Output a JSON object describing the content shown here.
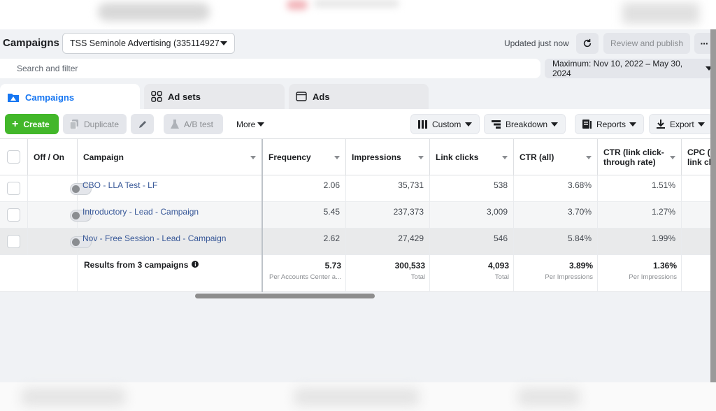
{
  "header": {
    "title": "Campaigns",
    "account": "TSS Seminole Advertising (335114927...",
    "updated": "Updated just now",
    "review_publish": "Review and publish"
  },
  "search": {
    "placeholder": "Search and filter"
  },
  "date_range": "Maximum: Nov 10, 2022 – May 30, 2024",
  "tabs": [
    {
      "label": "Campaigns",
      "icon": "folder-icon",
      "active": true
    },
    {
      "label": "Ad sets",
      "icon": "grid-icon",
      "active": false
    },
    {
      "label": "Ads",
      "icon": "ad-window-icon",
      "active": false
    }
  ],
  "toolbar": {
    "create": "Create",
    "duplicate": "Duplicate",
    "ab_test": "A/B test",
    "more": "More",
    "custom": "Custom",
    "breakdown": "Breakdown",
    "reports": "Reports",
    "export": "Export"
  },
  "columns": {
    "off_on": "Off / On",
    "campaign": "Campaign",
    "frequency": "Frequency",
    "impressions": "Impressions",
    "link_clicks": "Link clicks",
    "ctr_all": "CTR (all)",
    "ctr_link_1": "CTR (link click-",
    "ctr_link_2": "through rate)",
    "cpc_1": "CPC (c",
    "cpc_2": "link clic"
  },
  "rows": [
    {
      "campaign": "CBO - LLA Test - LF",
      "frequency": "2.06",
      "impressions": "35,731",
      "link_clicks": "538",
      "ctr_all": "3.68%",
      "ctr_link": "1.51%"
    },
    {
      "campaign": "Introductory - Lead - Campaign",
      "frequency": "5.45",
      "impressions": "237,373",
      "link_clicks": "3,009",
      "ctr_all": "3.70%",
      "ctr_link": "1.27%"
    },
    {
      "campaign": "Nov - Free Session - Lead - Campaign",
      "frequency": "2.62",
      "impressions": "27,429",
      "link_clicks": "546",
      "ctr_all": "5.84%",
      "ctr_link": "1.99%"
    }
  ],
  "totals": {
    "label": "Results from 3 campaigns",
    "frequency": "5.73",
    "frequency_sub": "Per Accounts Center a...",
    "impressions": "300,533",
    "impressions_sub": "Total",
    "link_clicks": "4,093",
    "link_clicks_sub": "Total",
    "ctr_all": "3.89%",
    "ctr_all_sub": "Per Impressions",
    "ctr_link": "1.36%",
    "ctr_link_sub": "Per Impressions"
  },
  "colors": {
    "accent": "#1877f2",
    "create": "#42b72a",
    "link": "#385898"
  }
}
